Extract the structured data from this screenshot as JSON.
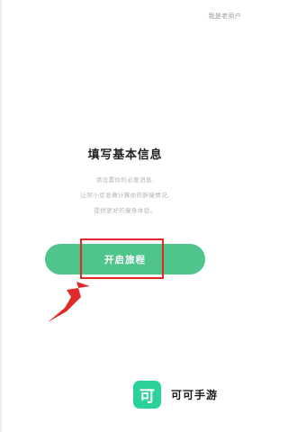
{
  "header": {
    "existing_user_link": "我是老用户"
  },
  "main": {
    "title": "填写基本信息",
    "description_lines": [
      "请设置你的必要消息,",
      "让阿小豆准确计算你的胖瘦情况,",
      "提供更好的瘦身体验。"
    ],
    "start_button_label": "开启旅程"
  },
  "annotation": {
    "highlight_color": "#e02a2a",
    "arrow_color": "#e02a2a"
  },
  "brand": {
    "logo_char": "可",
    "name": "可可手游",
    "logo_color": "#2bd19a"
  },
  "colors": {
    "primary_button": "#4fc58b"
  }
}
